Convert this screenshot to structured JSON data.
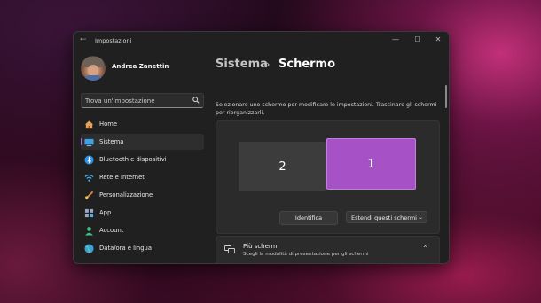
{
  "window": {
    "title": "Impostazioni",
    "back_glyph": "←",
    "minimize_glyph": "—",
    "maximize_glyph": "☐",
    "close_glyph": "✕"
  },
  "user": {
    "name": "Andrea Zanettin"
  },
  "search": {
    "placeholder": "Trova un'impostazione",
    "icon": "search-icon"
  },
  "sidebar": {
    "items": [
      {
        "label": "Home",
        "icon": "home-icon",
        "color": "#e8a25a"
      },
      {
        "label": "Sistema",
        "icon": "system-icon",
        "color": "#3ea2e6",
        "active": true
      },
      {
        "label": "Bluetooth e dispositivi",
        "icon": "bluetooth-icon",
        "color": "#2f8fe0"
      },
      {
        "label": "Rete e Internet",
        "icon": "wifi-icon",
        "color": "#4fb0f0"
      },
      {
        "label": "Personalizzazione",
        "icon": "brush-icon",
        "color": "#e0884a"
      },
      {
        "label": "App",
        "icon": "apps-icon",
        "color": "#9aa6c4"
      },
      {
        "label": "Account",
        "icon": "account-icon",
        "color": "#3ec28a"
      },
      {
        "label": "Data/ora e lingua",
        "icon": "globe-icon",
        "color": "#3aa0e0"
      }
    ]
  },
  "header": {
    "section": "Sistema",
    "separator": "›",
    "page": "Schermo"
  },
  "main": {
    "description": "Selezionare uno schermo per modificare le impostazioni. Trascinare gli schermi per riorganizzarli.",
    "monitors": [
      {
        "label": "2"
      },
      {
        "label": "1",
        "selected": true
      }
    ],
    "identify_button": "Identifica",
    "extend_select": "Estendi questi schermi",
    "multi_display": {
      "title": "Più schermi",
      "subtitle": "Scegli la modalità di presentazione per gli schermi"
    }
  },
  "colors": {
    "accent": "#a652c6",
    "window_bg": "#202020",
    "card_bg": "#2b2b2b"
  }
}
